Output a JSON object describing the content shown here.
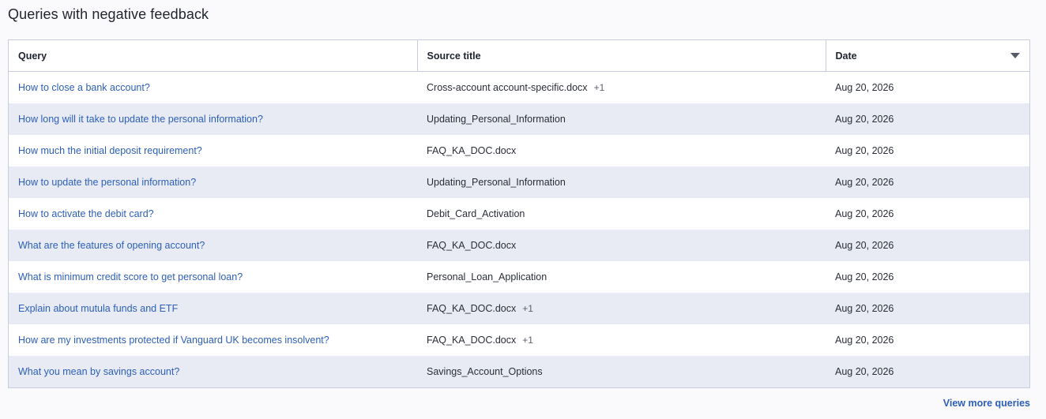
{
  "section": {
    "title": "Queries with negative feedback"
  },
  "table": {
    "headers": {
      "query": "Query",
      "source": "Source title",
      "date": "Date"
    },
    "sort_icon": "caret-down-icon",
    "rows": [
      {
        "query": "How to close a bank account?",
        "source": "Cross-account account-specific.docx",
        "extra": "+1",
        "date": "Aug 20, 2026"
      },
      {
        "query": "How long will it take to update the personal information?",
        "source": "Updating_Personal_Information",
        "extra": "",
        "date": "Aug 20, 2026"
      },
      {
        "query": "How much the initial deposit requirement?",
        "source": "FAQ_KA_DOC.docx",
        "extra": "",
        "date": "Aug 20, 2026"
      },
      {
        "query": "How to update the personal information?",
        "source": "Updating_Personal_Information",
        "extra": "",
        "date": "Aug 20, 2026"
      },
      {
        "query": "How to activate the debit card?",
        "source": "Debit_Card_Activation",
        "extra": "",
        "date": "Aug 20, 2026"
      },
      {
        "query": "What are the features of opening account?",
        "source": "FAQ_KA_DOC.docx",
        "extra": "",
        "date": "Aug 20, 2026"
      },
      {
        "query": "What is minimum credit score to get personal loan?",
        "source": "Personal_Loan_Application",
        "extra": "",
        "date": "Aug 20, 2026"
      },
      {
        "query": "Explain about mutula funds and ETF",
        "source": "FAQ_KA_DOC.docx",
        "extra": "+1",
        "date": "Aug 20, 2026"
      },
      {
        "query": "How are my investments protected if Vanguard UK becomes insolvent?",
        "source": "FAQ_KA_DOC.docx",
        "extra": "+1",
        "date": "Aug 20, 2026"
      },
      {
        "query": "What you mean by savings account?",
        "source": "Savings_Account_Options",
        "extra": "",
        "date": "Aug 20, 2026"
      }
    ]
  },
  "footer": {
    "view_more_label": "View more queries"
  },
  "colors": {
    "link": "#2d5fb8",
    "row_alt": "#e8ebf4",
    "border": "#c8cce0"
  }
}
